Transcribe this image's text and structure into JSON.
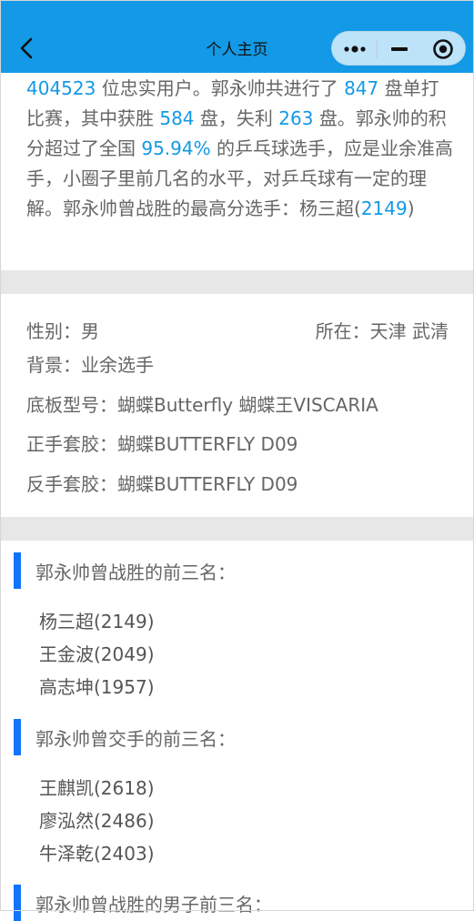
{
  "nav": {
    "title": "个人主页",
    "accent": "#1399e5"
  },
  "intro": {
    "t1": "位忠实用户。",
    "t2": "共进行了",
    "t3": "盘单打比赛，其中获胜",
    "t4": "盘，失利",
    "t5": "盘。",
    "t6": "的积分超过了全国",
    "t7": "的乒乓球选手，应是业余准高手，小圈子里前几名的水平，对乒乓球有一定的理解。",
    "t8": "曾战胜的最高分选手：杨三超(",
    "t9": ")",
    "user_count": "404523",
    "player": "郭永帅",
    "matches": "847",
    "wins": "584",
    "losses": "263",
    "percentile": "95.94%",
    "top_score": "2149"
  },
  "profile": {
    "gender": "性别：男",
    "location": "所在：天津 武清",
    "background": "背景：业余选手",
    "blade": "底板型号：蝴蝶Butterfly 蝴蝶王VISCARIA",
    "forehand": "正手套胶：蝴蝶BUTTERFLY D09",
    "backhand": "反手套胶：蝴蝶BUTTERFLY D09"
  },
  "sections": [
    {
      "title": "郭永帅曾战胜的前三名：",
      "items": [
        "杨三超(2149)",
        "王金波(2049)",
        "高志坤(1957)"
      ]
    },
    {
      "title": "郭永帅曾交手的前三名：",
      "items": [
        "王麒凯(2618)",
        "廖泓然(2486)",
        "牛泽乾(2403)"
      ]
    },
    {
      "title": "郭永帅曾战胜的男子前三名：",
      "items": []
    }
  ]
}
